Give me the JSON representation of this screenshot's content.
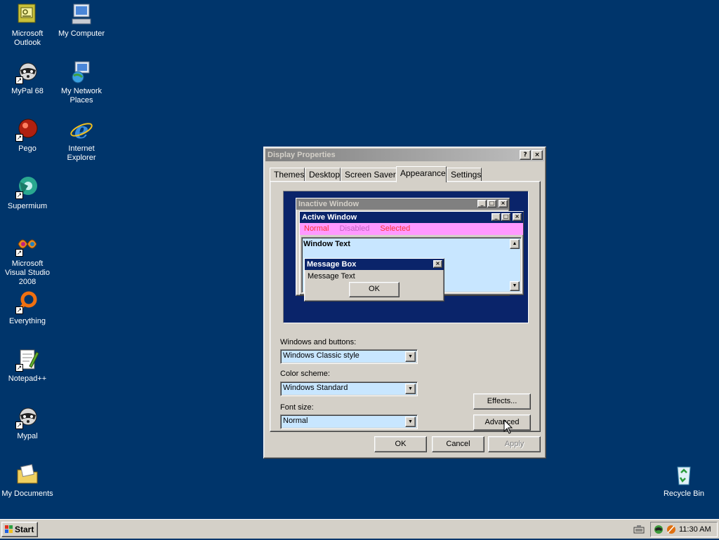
{
  "desktop": {
    "icons": [
      {
        "label": "Microsoft Outlook"
      },
      {
        "label": "My Computer"
      },
      {
        "label": "MyPal 68"
      },
      {
        "label": "My Network Places"
      },
      {
        "label": "Pego"
      },
      {
        "label": "Internet Explorer"
      },
      {
        "label": "Supermium"
      },
      {
        "label": "Microsoft Visual Studio 2008"
      },
      {
        "label": "Everything"
      },
      {
        "label": "Notepad++"
      },
      {
        "label": "Mypal"
      },
      {
        "label": "My Documents"
      },
      {
        "label": "Recycle Bin"
      }
    ]
  },
  "dialog": {
    "title": "Display Properties",
    "help_glyph": "?",
    "close_glyph": "×",
    "tabs": [
      {
        "label": "Themes"
      },
      {
        "label": "Desktop"
      },
      {
        "label": "Screen Saver"
      },
      {
        "label": "Appearance"
      },
      {
        "label": "Settings"
      }
    ],
    "active_tab": "Appearance",
    "preview": {
      "inactive_title": "Inactive Window",
      "active_title": "Active Window",
      "menu_normal": "Normal",
      "menu_disabled": "Disabled",
      "menu_selected": "Selected",
      "window_text": "Window Text",
      "message_title": "Message Box",
      "message_text": "Message Text",
      "ok_label": "OK",
      "minimize_glyph": "_",
      "maximize_glyph": "□",
      "close_glyph": "×"
    },
    "windows_buttons_label": "Windows and buttons:",
    "windows_buttons_value": "Windows Classic style",
    "color_scheme_label": "Color scheme:",
    "color_scheme_value": "Windows Standard",
    "font_size_label": "Font size:",
    "font_size_value": "Normal",
    "effects_label": "Effects...",
    "advanced_label": "Advanced",
    "ok_label": "OK",
    "cancel_label": "Cancel",
    "apply_label": "Apply"
  },
  "taskbar": {
    "start_label": "Start",
    "clock": "11:30 AM"
  },
  "colors": {
    "desktop_bg": "#00356b",
    "active_caption": "#0a246a",
    "inactive_caption": "#808080",
    "menu_bg": "#ff99ff",
    "window_bg": "#c8e6ff"
  }
}
